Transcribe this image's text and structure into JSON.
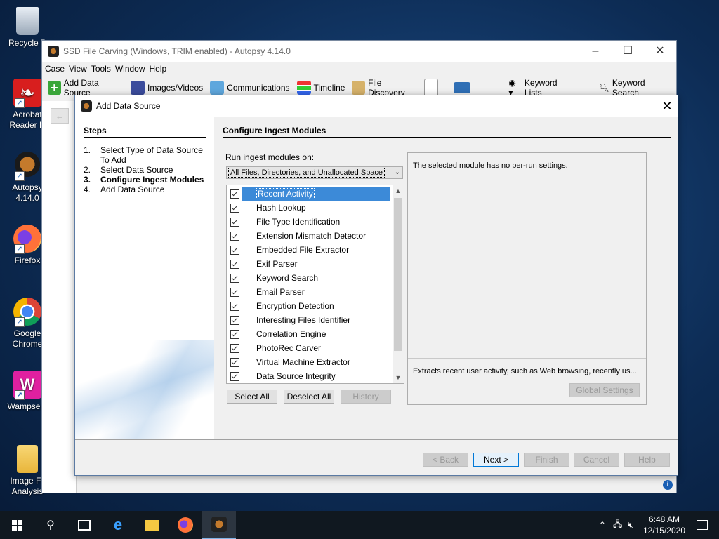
{
  "desktop": {
    "icons": [
      {
        "label": "Recycle B",
        "icon": "recycle-bin-icon"
      },
      {
        "label": "Acrobat Reader D",
        "icon": "acrobat-icon"
      },
      {
        "label": "Autopsy 4.14.0",
        "icon": "autopsy-icon"
      },
      {
        "label": "Firefox",
        "icon": "firefox-icon"
      },
      {
        "label": "Google Chrome",
        "icon": "chrome-icon"
      },
      {
        "label": "Wampserv",
        "icon": "wampserver-icon"
      },
      {
        "label": "Image Fil Analysis",
        "icon": "folder-icon"
      }
    ]
  },
  "main_window": {
    "title": "SSD File Carving (Windows, TRIM enabled) - Autopsy 4.14.0",
    "menu": [
      "Case",
      "View",
      "Tools",
      "Window",
      "Help"
    ],
    "toolbar": {
      "add_data_source": "Add Data Source",
      "images_videos": "Images/Videos",
      "communications": "Communications",
      "timeline": "Timeline",
      "file_discovery": "File Discovery",
      "keyword_lists": "Keyword Lists",
      "keyword_search": "Keyword Search"
    }
  },
  "dialog": {
    "title": "Add Data Source",
    "steps_heading": "Steps",
    "steps": [
      {
        "num": "1.",
        "label": "Select Type of Data Source To Add"
      },
      {
        "num": "2.",
        "label": "Select Data Source"
      },
      {
        "num": "3.",
        "label": "Configure Ingest Modules"
      },
      {
        "num": "4.",
        "label": "Add Data Source"
      }
    ],
    "content_heading": "Configure Ingest Modules",
    "run_on_label": "Run ingest modules on:",
    "run_on_value": "All Files, Directories, and Unallocated Space",
    "modules": [
      {
        "name": "Recent Activity",
        "checked": true,
        "selected": true
      },
      {
        "name": "Hash Lookup",
        "checked": true
      },
      {
        "name": "File Type Identification",
        "checked": true
      },
      {
        "name": "Extension Mismatch Detector",
        "checked": true
      },
      {
        "name": "Embedded File Extractor",
        "checked": true
      },
      {
        "name": "Exif Parser",
        "checked": true
      },
      {
        "name": "Keyword Search",
        "checked": true
      },
      {
        "name": "Email Parser",
        "checked": true
      },
      {
        "name": "Encryption Detection",
        "checked": true
      },
      {
        "name": "Interesting Files Identifier",
        "checked": true
      },
      {
        "name": "Correlation Engine",
        "checked": true
      },
      {
        "name": "PhotoRec Carver",
        "checked": true
      },
      {
        "name": "Virtual Machine Extractor",
        "checked": true
      },
      {
        "name": "Data Source Integrity",
        "checked": true
      }
    ],
    "list_buttons": {
      "select_all": "Select All",
      "deselect_all": "Deselect All",
      "history": "History"
    },
    "settings_text": "The selected module has no per-run settings.",
    "description_text": "Extracts recent user activity, such as Web browsing, recently us...",
    "global_settings": "Global Settings",
    "nav_buttons": {
      "back": "< Back",
      "next": "Next >",
      "finish": "Finish",
      "cancel": "Cancel",
      "help": "Help"
    }
  },
  "taskbar": {
    "time": "6:48 AM",
    "date": "12/15/2020"
  }
}
